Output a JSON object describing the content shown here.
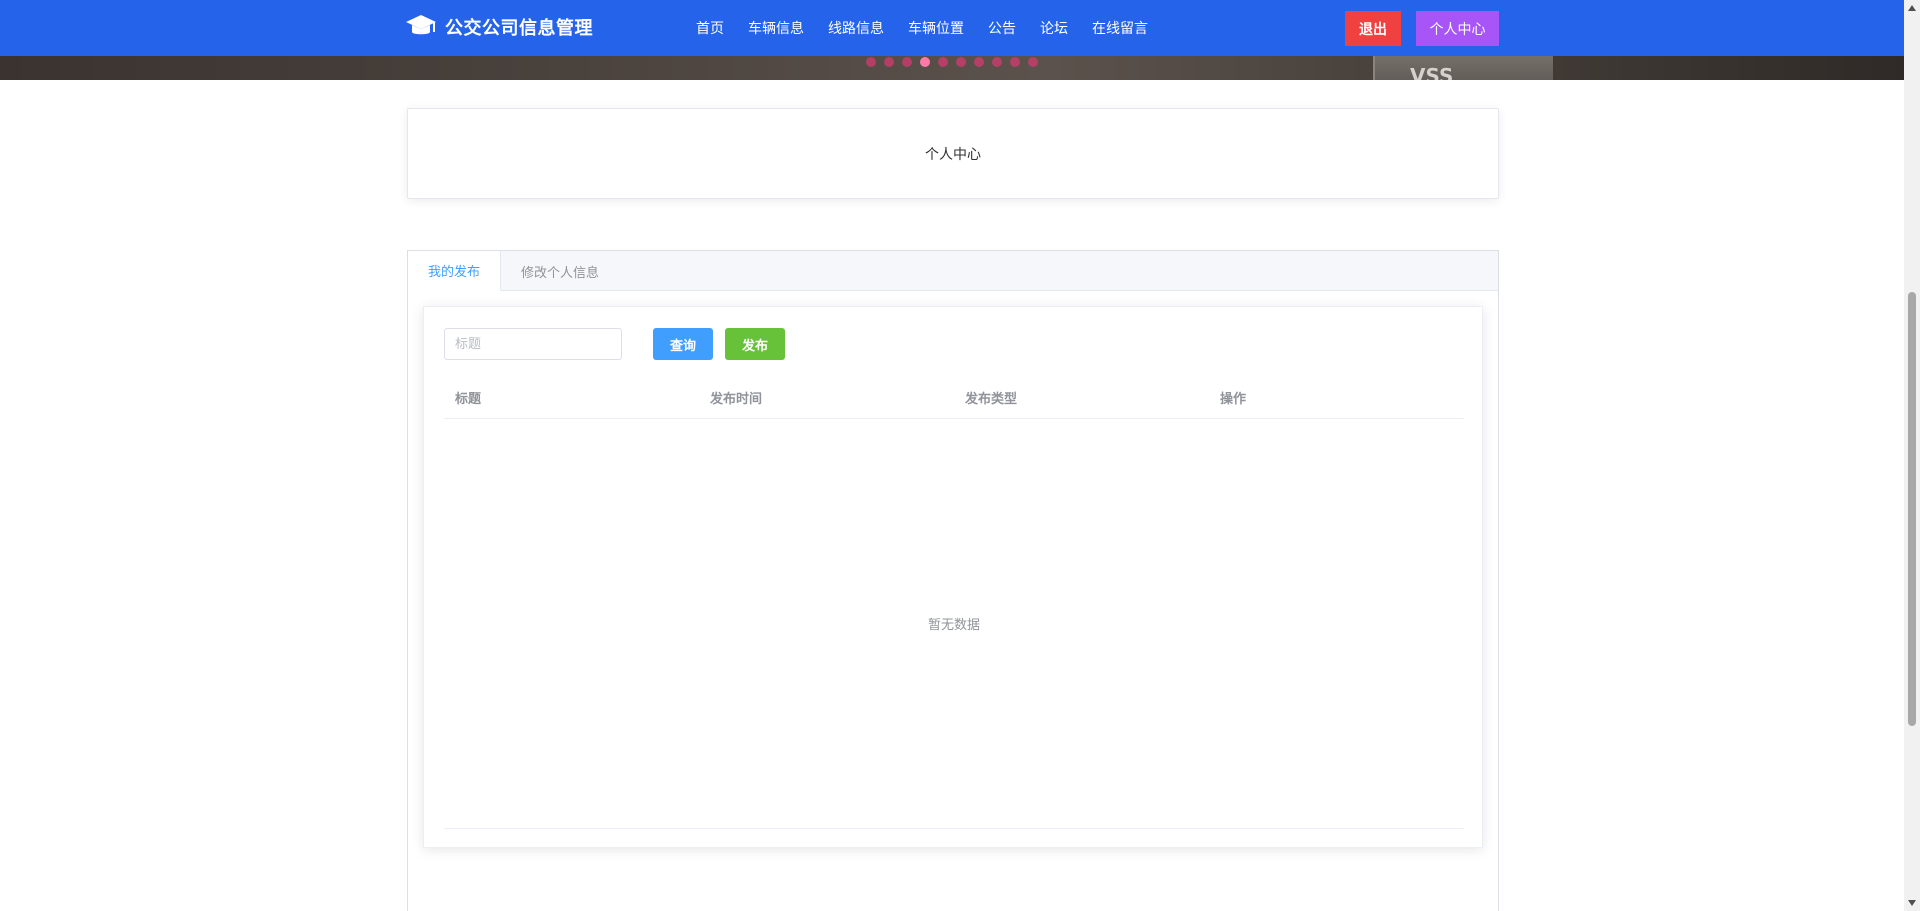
{
  "banner": {
    "headline": "",
    "dots_count": 10,
    "active_dot_index": 3,
    "bus_text": "VSS"
  },
  "header": {
    "logo_text": "公交公司信息管理",
    "nav": [
      {
        "label": "首页"
      },
      {
        "label": "车辆信息"
      },
      {
        "label": "线路信息"
      },
      {
        "label": "车辆位置"
      },
      {
        "label": "公告"
      },
      {
        "label": "论坛"
      },
      {
        "label": "在线留言"
      }
    ],
    "logout_label": "退出",
    "profile_label": "个人中心"
  },
  "title_card": {
    "title": "个人中心"
  },
  "tabs": [
    {
      "label": "我的发布",
      "active": true
    },
    {
      "label": "修改个人信息",
      "active": false
    }
  ],
  "filter": {
    "title_placeholder": "标题",
    "query_label": "查询",
    "publish_label": "发布"
  },
  "table": {
    "columns": [
      "标题",
      "发布时间",
      "发布类型",
      "操作"
    ],
    "rows": [],
    "empty_text": "暂无数据"
  },
  "colors": {
    "header_bg": "#2563eb",
    "logout_bg": "#f04141",
    "profile_bg": "#a855f7",
    "query_bg": "#409eff",
    "publish_bg": "#67c23a",
    "tab_active": "#409eff"
  }
}
